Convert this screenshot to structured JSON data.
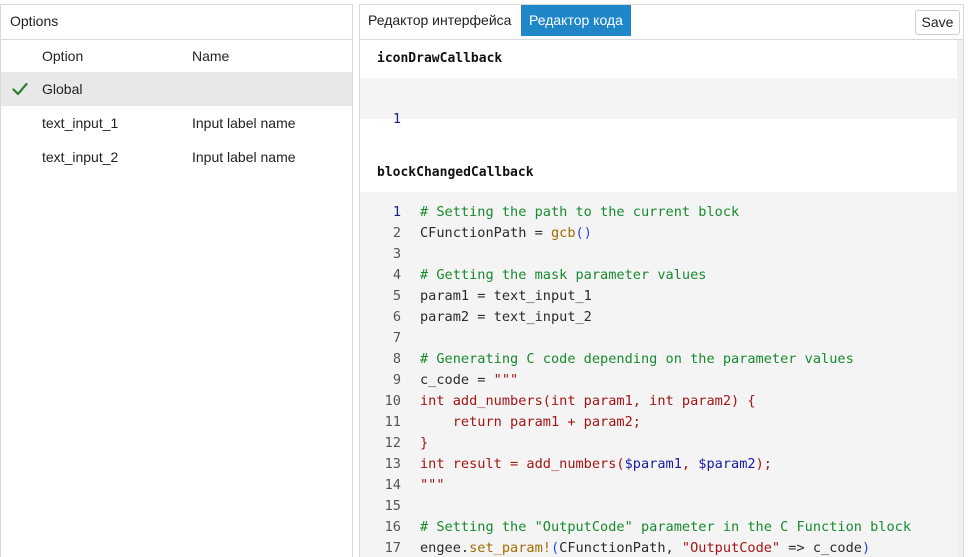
{
  "options_panel": {
    "title": "Options",
    "columns": [
      "Option",
      "Name"
    ],
    "rows": [
      {
        "option": "Global",
        "name": "",
        "selected": true
      },
      {
        "option": "text_input_1",
        "name": "Input label name",
        "selected": false
      },
      {
        "option": "text_input_2",
        "name": "Input label name",
        "selected": false
      }
    ]
  },
  "editor": {
    "tabs": [
      "Редактор интерфейса",
      "Редактор кода"
    ],
    "active_tab": "Редактор кода",
    "save_label": "Save",
    "sections": [
      {
        "title": "iconDrawCallback",
        "lines": [
          ""
        ]
      },
      {
        "title": "blockChangedCallback",
        "lines": [
          "# Setting the path to the current block",
          "CFunctionPath = gcb()",
          "",
          "# Getting the mask parameter values",
          "param1 = text_input_1",
          "param2 = text_input_2",
          "",
          "# Generating C code depending on the parameter values",
          "c_code = \"\"\"",
          "int add_numbers(int param1, int param2) {",
          "    return param1 + param2;",
          "}",
          "int result = add_numbers($param1, $param2);",
          "\"\"\"",
          "",
          "# Setting the \"OutputCode\" parameter in the C Function block",
          "engee.set_param!(CFunctionPath, \"OutputCode\" => c_code)"
        ]
      }
    ]
  },
  "colors": {
    "active_tab_bg": "#1f86c7",
    "selected_row_bg": "#e8e8e8",
    "check_color": "#2e7d32",
    "comment": "#198a2f",
    "string": "#a31515"
  }
}
